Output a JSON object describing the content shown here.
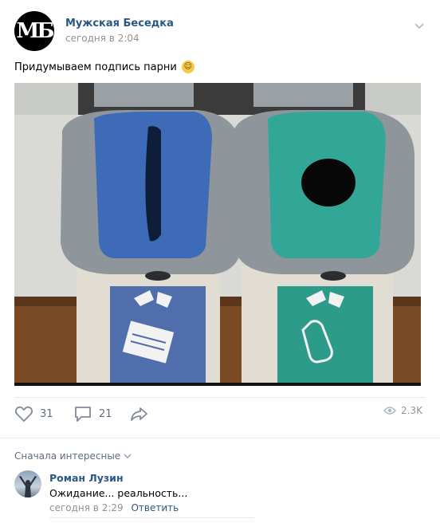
{
  "post": {
    "author": "Мужская Беседка",
    "logo_text": "МБ",
    "time": "сегодня в 2:04",
    "text": "Придумываем подпись парни",
    "emoji": "laughing-emoji"
  },
  "actions": {
    "likes": "31",
    "comments": "21",
    "views": "2.3K"
  },
  "comments_section": {
    "sort_label": "Сначала интересные",
    "items": [
      {
        "author": "Роман Лузин",
        "text": "Ожидание... реальность...",
        "time": "сегодня в 2:29",
        "reply_label": "Ответить"
      }
    ]
  },
  "colors": {
    "link": "#2a5885",
    "muted": "#939393",
    "divider": "#e7e8ec"
  }
}
